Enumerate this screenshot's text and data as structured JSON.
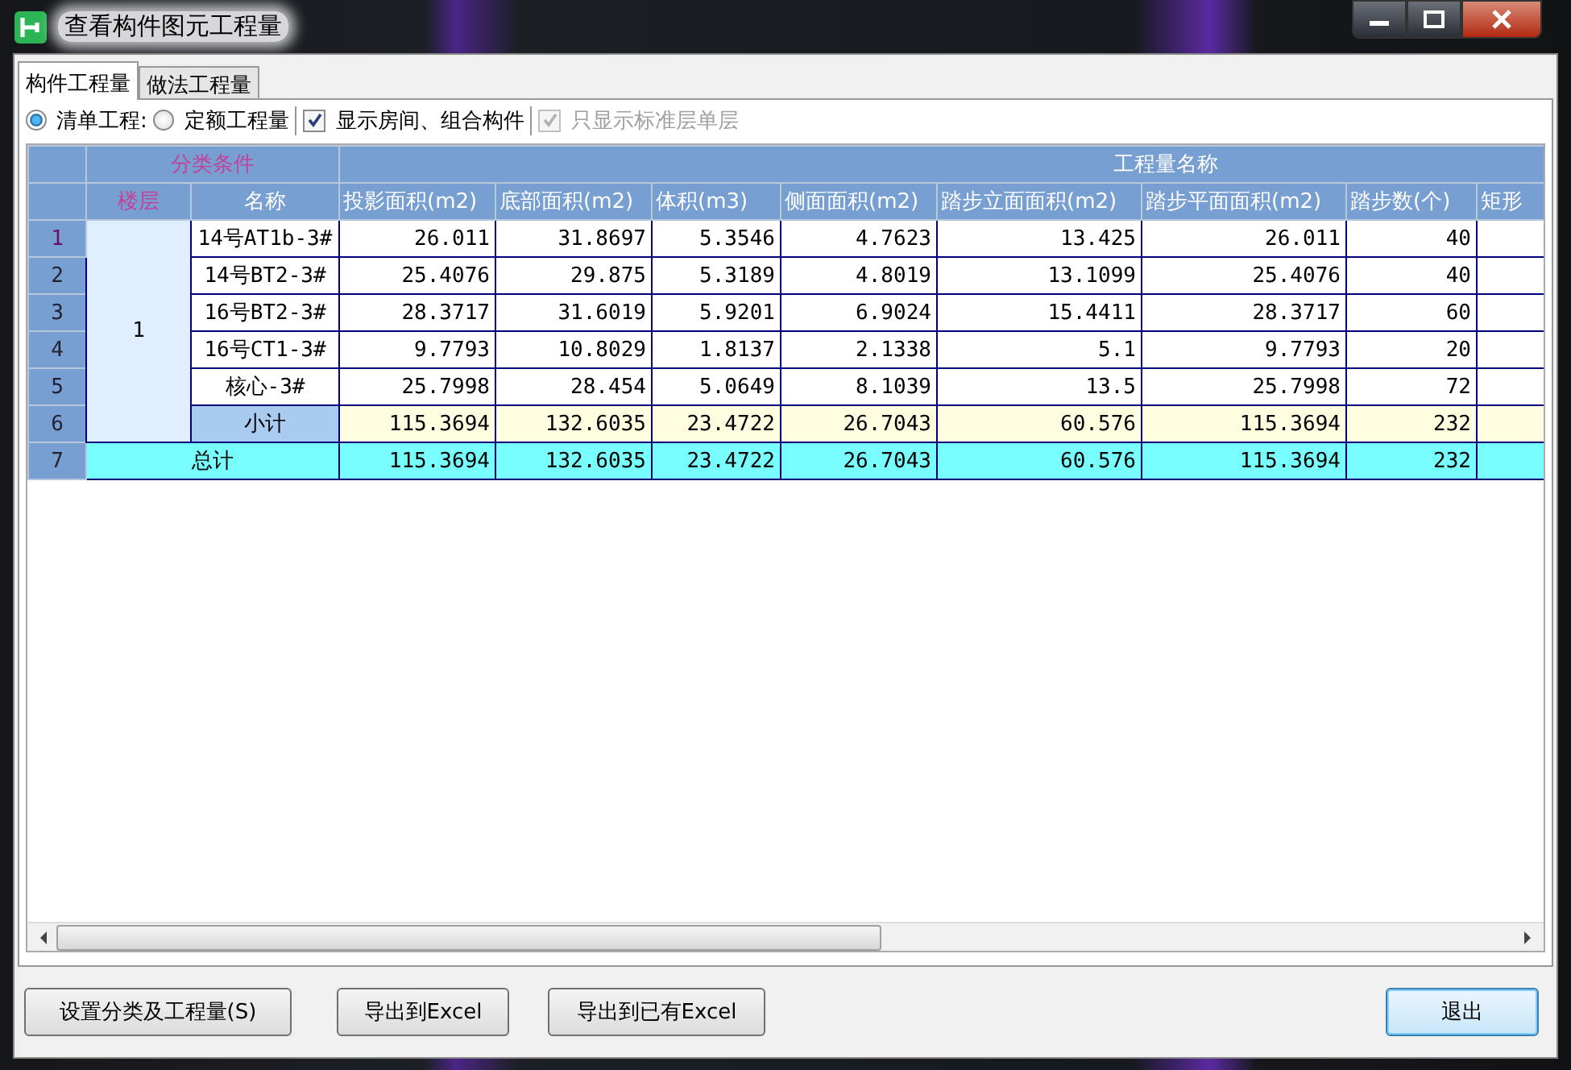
{
  "window": {
    "title": "查看构件图元工程量"
  },
  "tabs": [
    {
      "label": "构件工程量",
      "selected": true
    },
    {
      "label": "做法工程量",
      "selected": false
    }
  ],
  "options": [
    {
      "kind": "radio",
      "label": "清单工程:",
      "checked": true,
      "disabled": false
    },
    {
      "kind": "radio",
      "label": "定额工程量",
      "checked": false,
      "disabled": false
    },
    {
      "kind": "checkbox",
      "label": "显示房间、组合构件",
      "checked": true,
      "disabled": false
    },
    {
      "kind": "checkbox",
      "label": "只显示标准层单层",
      "checked": true,
      "disabled": true
    }
  ],
  "table": {
    "group_headers": [
      "分类条件",
      "工程量名称"
    ],
    "key_columns": [
      "楼层",
      "名称"
    ],
    "columns": [
      "投影面积(m2)",
      "底部面积(m2)",
      "体积(m3)",
      "侧面面积(m2)",
      "踏步立面面积(m2)",
      "踏步平面面积(m2)",
      "踏步数(个)",
      "矩形"
    ],
    "floor": "1",
    "rows": [
      {
        "number": "1",
        "kind": "item",
        "name": "14号AT1b-3#",
        "values": [
          "26.011",
          "31.8697",
          "5.3546",
          "4.7623",
          "13.425",
          "26.011",
          "40"
        ]
      },
      {
        "number": "2",
        "kind": "item",
        "name": "14号BT2-3#",
        "values": [
          "25.4076",
          "29.875",
          "5.3189",
          "4.8019",
          "13.1099",
          "25.4076",
          "40"
        ]
      },
      {
        "number": "3",
        "kind": "item",
        "name": "16号BT2-3#",
        "values": [
          "28.3717",
          "31.6019",
          "5.9201",
          "6.9024",
          "15.4411",
          "28.3717",
          "60"
        ]
      },
      {
        "number": "4",
        "kind": "item",
        "name": "16号CT1-3#",
        "values": [
          "9.7793",
          "10.8029",
          "1.8137",
          "2.1338",
          "5.1",
          "9.7793",
          "20"
        ]
      },
      {
        "number": "5",
        "kind": "item",
        "name": "核心-3#",
        "values": [
          "25.7998",
          "28.454",
          "5.0649",
          "8.1039",
          "13.5",
          "25.7998",
          "72"
        ]
      },
      {
        "number": "6",
        "kind": "subtotal",
        "name": "小计",
        "values": [
          "115.3694",
          "132.6035",
          "23.4722",
          "26.7043",
          "60.576",
          "115.3694",
          "232"
        ]
      },
      {
        "number": "7",
        "kind": "total",
        "name": "总计",
        "values": [
          "115.3694",
          "132.6035",
          "23.4722",
          "26.7043",
          "60.576",
          "115.3694",
          "232"
        ]
      }
    ]
  },
  "buttons": [
    {
      "label": "设置分类及工程量(S)",
      "default": false
    },
    {
      "label": "导出到Excel",
      "default": false
    },
    {
      "label": "导出到已有Excel",
      "default": false
    },
    {
      "label": "退出",
      "default": true
    }
  ]
}
